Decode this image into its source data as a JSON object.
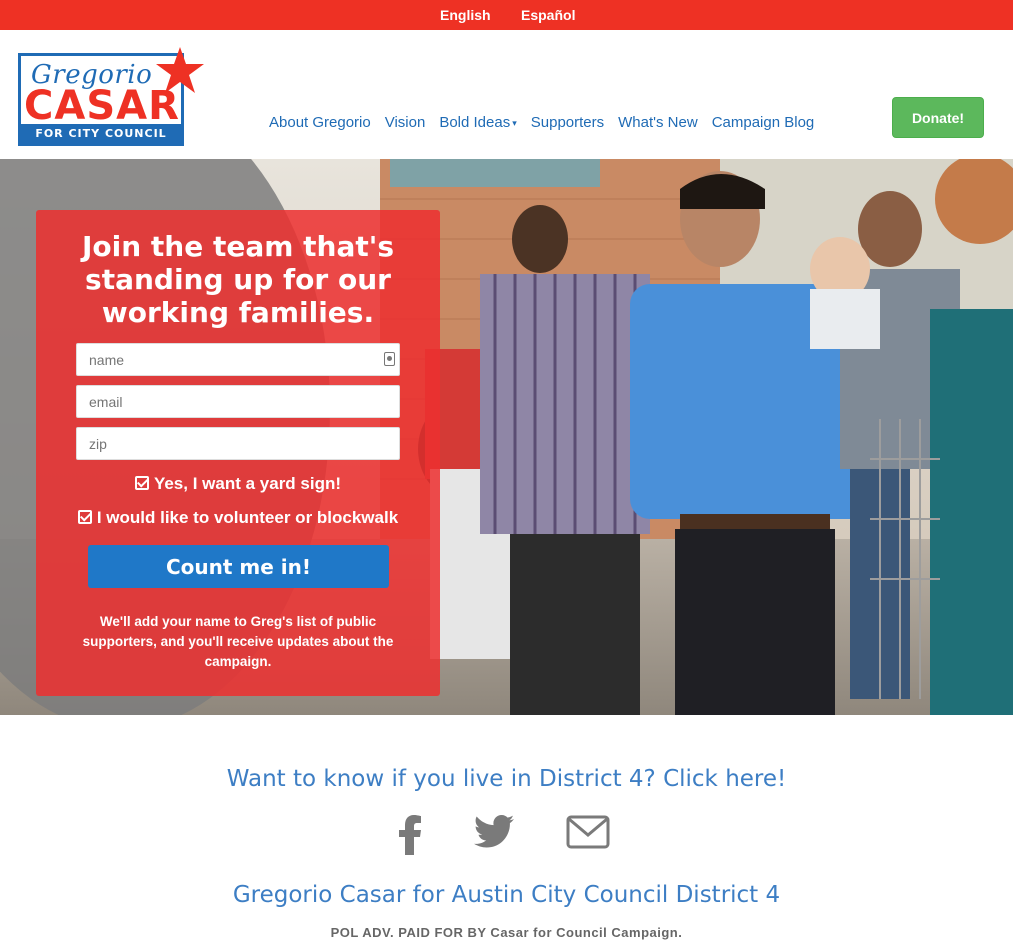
{
  "languages": {
    "english": "English",
    "spanish": "Español"
  },
  "logo": {
    "script_name": "Gregorio",
    "surname": "CASAR",
    "tagline": "FOR CITY COUNCIL"
  },
  "nav": {
    "items": [
      {
        "label": "About Gregorio"
      },
      {
        "label": "Vision"
      },
      {
        "label": "Bold Ideas",
        "has_dropdown": true
      },
      {
        "label": "Supporters"
      },
      {
        "label": "What's New"
      },
      {
        "label": "Campaign Blog"
      }
    ],
    "donate_label": "Donate!"
  },
  "signup": {
    "title": "Join the team that's standing up for our working families.",
    "name_placeholder": "name",
    "email_placeholder": "email",
    "zip_placeholder": "zip",
    "yard_sign_label": "Yes, I want a yard sign!",
    "volunteer_label": "I would like to volunteer or blockwalk",
    "submit_label": "Count me in!",
    "note": "We'll add your name to Greg's list of public supporters, and you'll receive updates about the campaign."
  },
  "footer": {
    "district_link": "Want to know if you live in District 4? Click here!",
    "social_icons": [
      "facebook-icon",
      "twitter-icon",
      "mail-icon"
    ],
    "title": "Gregorio Casar for Austin City Council District 4",
    "disclaimer": "POL ADV. PAID FOR BY Casar for Council Campaign."
  },
  "colors": {
    "accent_red": "#ee3124",
    "brand_blue": "#1f6bb5",
    "link_blue": "#3d7ec4",
    "donate_green": "#5cb85c",
    "button_blue": "#1f78c8"
  }
}
